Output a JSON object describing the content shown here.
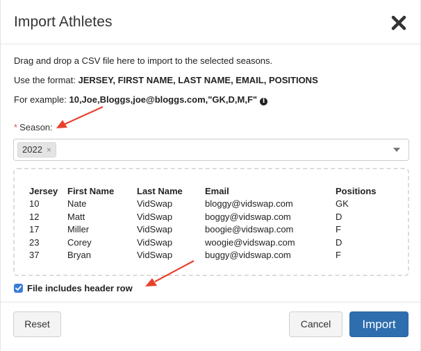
{
  "dialog": {
    "title": "Import Athletes",
    "close_icon": "close-icon"
  },
  "instructions": {
    "line1": "Drag and drop a CSV file here to import to the selected seasons.",
    "format_prefix": "Use the format: ",
    "format_value": "JERSEY, FIRST NAME, LAST NAME, EMAIL, POSITIONS",
    "example_prefix": "For example: ",
    "example_value": "10,Joe,Bloggs,joe@bloggs.com,\"GK,D,M,F\"",
    "info_icon": "info-icon"
  },
  "season": {
    "required_marker": "*",
    "label": "Season:",
    "selected": [
      "2022"
    ],
    "chip_remove_glyph": "×"
  },
  "table": {
    "columns": [
      "Jersey",
      "First Name",
      "Last Name",
      "Email",
      "Positions"
    ],
    "rows": [
      [
        "10",
        "Nate",
        "VidSwap",
        "bloggy@vidswap.com",
        "GK"
      ],
      [
        "12",
        "Matt",
        "VidSwap",
        "boggy@vidswap.com",
        "D"
      ],
      [
        "17",
        "Miller",
        "VidSwap",
        "boogie@vidswap.com",
        "F"
      ],
      [
        "23",
        "Corey",
        "VidSwap",
        "woogie@vidswap.com",
        "D"
      ],
      [
        "37",
        "Bryan",
        "VidSwap",
        "buggy@vidswap.com",
        "F"
      ]
    ]
  },
  "header_row_checkbox": {
    "label": "File includes header row",
    "checked": true
  },
  "footer": {
    "reset_label": "Reset",
    "cancel_label": "Cancel",
    "import_label": "Import"
  },
  "colors": {
    "primary": "#2f6eae",
    "checkbox": "#3b7dd8",
    "required": "#d9534f",
    "annotation_arrow": "#e8412c"
  }
}
